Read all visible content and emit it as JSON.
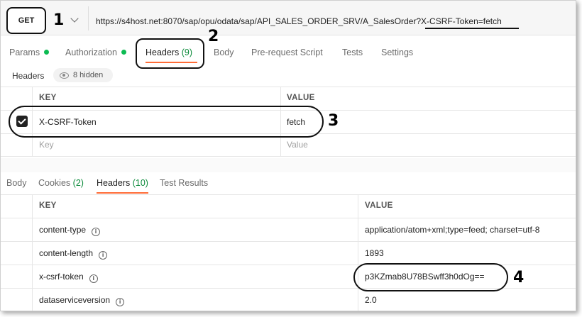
{
  "request": {
    "method": "GET",
    "url": "https://s4host.net:8070/sap/opu/odata/sap/API_SALES_ORDER_SRV/A_SalesOrder?X-CSRF-Token=fetch"
  },
  "annotations": [
    "1",
    "2",
    "3",
    "4"
  ],
  "request_tabs": [
    {
      "label": "Params",
      "dot": true
    },
    {
      "label": "Authorization",
      "dot": true
    },
    {
      "label": "Headers",
      "count": "(9)"
    },
    {
      "label": "Body"
    },
    {
      "label": "Pre-request Script"
    },
    {
      "label": "Tests"
    },
    {
      "label": "Settings"
    }
  ],
  "headers_section": {
    "label": "Headers",
    "hidden": "8 hidden"
  },
  "request_headers": {
    "col_key": "KEY",
    "col_value": "VALUE",
    "rows": [
      {
        "key": "X-CSRF-Token",
        "value": "fetch",
        "checked": true
      }
    ],
    "placeholder_key": "Key",
    "placeholder_value": "Value"
  },
  "response_tabs": [
    {
      "label": "Body"
    },
    {
      "label": "Cookies",
      "count": "(2)"
    },
    {
      "label": "Headers",
      "count": "(10)"
    },
    {
      "label": "Test Results"
    }
  ],
  "response_headers": {
    "col_key": "KEY",
    "col_value": "VALUE",
    "rows": [
      {
        "key": "content-type",
        "value": "application/atom+xml;type=feed; charset=utf-8"
      },
      {
        "key": "content-length",
        "value": "1893"
      },
      {
        "key": "x-csrf-token",
        "value": "p3KZmab8U78BSwff3h0dOg=="
      },
      {
        "key": "dataserviceversion",
        "value": "2.0"
      }
    ]
  },
  "colors": {
    "accent": "#ff6c37",
    "status_dot": "#0cbb52",
    "count": "#0b8a3a"
  }
}
